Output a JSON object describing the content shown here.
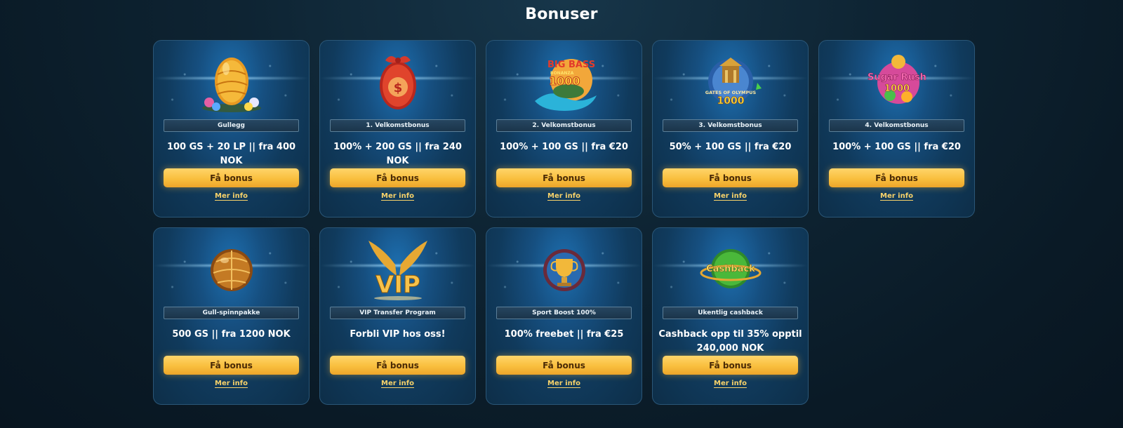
{
  "title": "Bonuser",
  "cards": [
    {
      "art": "golden-egg-icon",
      "label": "Gullegg",
      "desc": "100 GS + 20 LP || fra 400 NOK",
      "button": "Få bonus",
      "more": "Mer info"
    },
    {
      "art": "red-egg-dollar-icon",
      "label": "1. Velkomstbonus",
      "desc": "100% + 200 GS || fra 240 NOK",
      "button": "Få bonus",
      "more": "Mer info"
    },
    {
      "art": "big-bass-bonanza-icon",
      "label": "2. Velkomstbonus",
      "desc": "100% + 100 GS || fra €20",
      "button": "Få bonus",
      "more": "Mer info"
    },
    {
      "art": "gates-of-olympus-icon",
      "label": "3. Velkomstbonus",
      "desc": "50% + 100 GS || fra €20",
      "button": "Få bonus",
      "more": "Mer info"
    },
    {
      "art": "sugar-rush-icon",
      "label": "4. Velkomstbonus",
      "desc": "100% + 100 GS || fra €20",
      "button": "Få bonus",
      "more": "Mer info"
    },
    {
      "art": "golden-ball-icon",
      "label": "Gull-spinnpakke",
      "desc": "500 GS || fra 1200 NOK",
      "button": "Få bonus",
      "more": "Mer info"
    },
    {
      "art": "vip-wings-icon",
      "label": "VIP Transfer Program",
      "desc": "Forbli VIP hos oss!",
      "button": "Få bonus",
      "more": "Mer info"
    },
    {
      "art": "trophy-orb-icon",
      "label": "Sport Boost 100%",
      "desc": "100% freebet || fra €25",
      "button": "Få bonus",
      "more": "Mer info"
    },
    {
      "art": "cashback-orb-icon",
      "label": "Ukentlig cashback",
      "desc": "Cashback opp til 35% opptil 240,000 NOK",
      "button": "Få bonus",
      "more": "Mer info"
    }
  ],
  "art_text": {
    "big_bass": "BIG BASS",
    "bonanza": "BONANZA",
    "big_bass_num": "1000",
    "gates": "GATES OF OLYMPUS",
    "gates_num": "1000",
    "sugar": "Sugar Rush",
    "sugar_num": "1000",
    "vip": "VIP",
    "cashback": "Cashback"
  },
  "colors": {
    "accent_gold": "#f9bf3e",
    "link_gold": "#f7d26a",
    "card_blue": "#164f80",
    "background": "#0a1a26"
  }
}
